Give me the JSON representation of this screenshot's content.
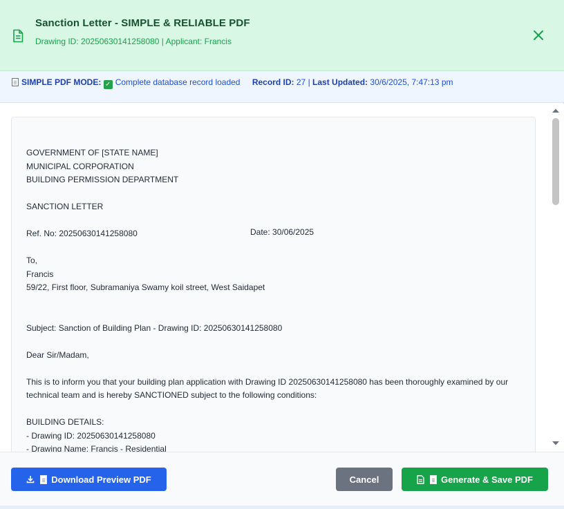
{
  "header": {
    "title": "Sanction Letter - SIMPLE & RELIABLE PDF",
    "subtitle": "Drawing ID: 20250630141258080 | Applicant: Francis"
  },
  "infobar": {
    "mode_label": "SIMPLE PDF MODE:",
    "mode_status": "Complete database record loaded",
    "record_label": "Record ID:",
    "record_value": "27",
    "separator": "|",
    "updated_label": "Last Updated:",
    "updated_value": "30/6/2025, 7:47:13 pm"
  },
  "letter": {
    "content": "GOVERNMENT OF [STATE NAME]\nMUNICIPAL CORPORATION\nBUILDING PERMISSION DEPARTMENT\n\nSANCTION LETTER\n\nRef. No: 20250630141258080\n\nTo,\nFrancis\n59/22, First floor, Subramaniya Swamy koil street, West Saidapet\n\n\nSubject: Sanction of Building Plan - Drawing ID: 20250630141258080\n\nDear Sir/Madam,\n\nThis is to inform you that your building plan application with Drawing ID 20250630141258080 has been thoroughly examined by our technical team and is hereby SANCTIONED subject to the following conditions:\n\nBUILDING DETAILS:\n- Drawing ID: 20250630141258080\n- Drawing Name: Francis - Residential",
    "date": "Date: 30/06/2025"
  },
  "footer": {
    "preview_label": "Download Preview PDF",
    "cancel_label": "Cancel",
    "save_label": "Generate & Save PDF"
  },
  "colors": {
    "header_bg": "#d9f7e5",
    "title": "#14532d",
    "accent_green": "#16a34a",
    "info_blue": "#1d4ed8",
    "preview_btn": "#2563eb",
    "cancel_btn": "#6b7280"
  },
  "icons": {
    "header": "document-icon",
    "close": "close-icon",
    "preview": "download-icon",
    "save": "document-icon"
  }
}
